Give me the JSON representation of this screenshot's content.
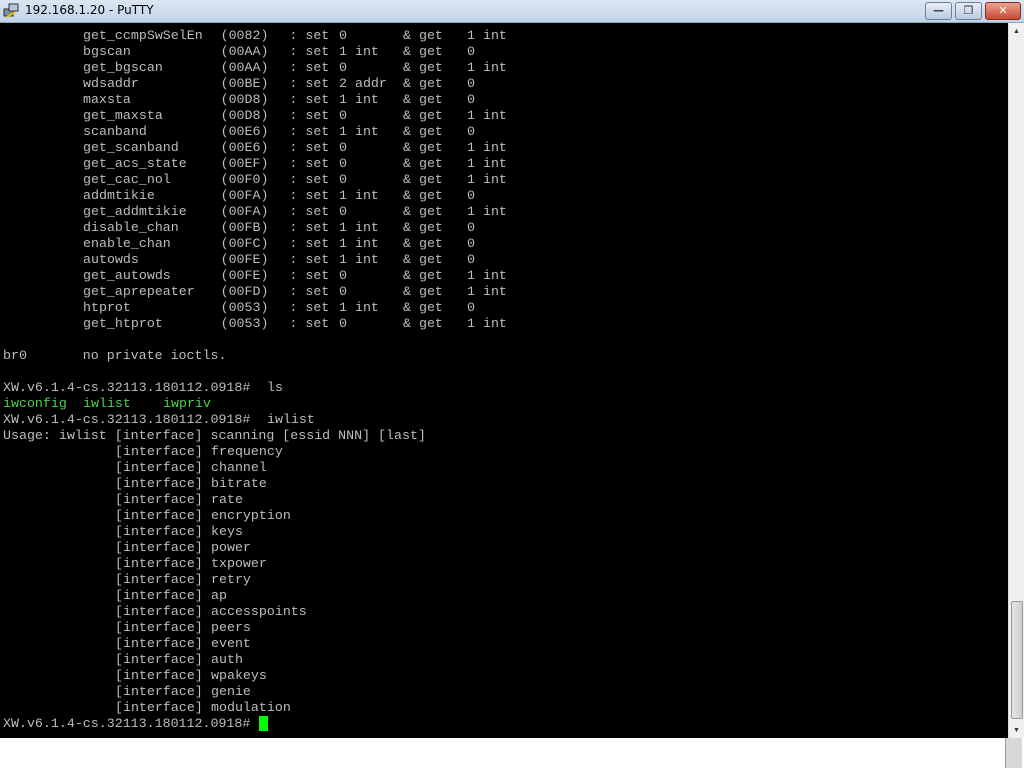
{
  "window": {
    "title": "192.168.1.20 - PuTTY",
    "minimize_label": "—",
    "restore_label": "❐",
    "close_label": "✕"
  },
  "colors": {
    "terminal_bg": "#000000",
    "text": "#bdbdbd",
    "exec_green": "#4fd04f",
    "cursor": "#00ff00"
  },
  "ioctl_table": [
    {
      "name": "get_ccmpSwSelEn",
      "code": "(0082)",
      "set": "0",
      "get": "1 int"
    },
    {
      "name": "bgscan",
      "code": "(00AA)",
      "set": "1 int",
      "get": "0"
    },
    {
      "name": "get_bgscan",
      "code": "(00AA)",
      "set": "0",
      "get": "1 int"
    },
    {
      "name": "wdsaddr",
      "code": "(00BE)",
      "set": "2 addr",
      "get": "0"
    },
    {
      "name": "maxsta",
      "code": "(00D8)",
      "set": "1 int",
      "get": "0"
    },
    {
      "name": "get_maxsta",
      "code": "(00D8)",
      "set": "0",
      "get": "1 int"
    },
    {
      "name": "scanband",
      "code": "(00E6)",
      "set": "1 int",
      "get": "0"
    },
    {
      "name": "get_scanband",
      "code": "(00E6)",
      "set": "0",
      "get": "1 int"
    },
    {
      "name": "get_acs_state",
      "code": "(00EF)",
      "set": "0",
      "get": "1 int"
    },
    {
      "name": "get_cac_nol",
      "code": "(00F0)",
      "set": "0",
      "get": "1 int"
    },
    {
      "name": "addmtikie",
      "code": "(00FA)",
      "set": "1 int",
      "get": "0"
    },
    {
      "name": "get_addmtikie",
      "code": "(00FA)",
      "set": "0",
      "get": "1 int"
    },
    {
      "name": "disable_chan",
      "code": "(00FB)",
      "set": "1 int",
      "get": "0"
    },
    {
      "name": "enable_chan",
      "code": "(00FC)",
      "set": "1 int",
      "get": "0"
    },
    {
      "name": "autowds",
      "code": "(00FE)",
      "set": "1 int",
      "get": "0"
    },
    {
      "name": "get_autowds",
      "code": "(00FE)",
      "set": "0",
      "get": "1 int"
    },
    {
      "name": "get_aprepeater",
      "code": "(00FD)",
      "set": "0",
      "get": "1 int"
    },
    {
      "name": "htprot",
      "code": "(0053)",
      "set": "1 int",
      "get": "0"
    },
    {
      "name": "get_htprot",
      "code": "(0053)",
      "set": "0",
      "get": "1 int"
    }
  ],
  "table_labels": {
    "sep": ": set",
    "amp": "& get"
  },
  "br0_line": "br0       no private ioctls.",
  "prompt": "XW.v6.1.4-cs.32113.180112.0918#",
  "cmd_ls": "ls",
  "ls_output": [
    "iwconfig",
    "iwlist",
    "iwpriv"
  ],
  "cmd_iwlist": "iwlist",
  "usage_line": "Usage: iwlist [interface] scanning [essid NNN] [last]",
  "usage_options": [
    "frequency",
    "channel",
    "bitrate",
    "rate",
    "encryption",
    "keys",
    "power",
    "txpower",
    "retry",
    "ap",
    "accesspoints",
    "peers",
    "event",
    "auth",
    "wpakeys",
    "genie",
    "modulation"
  ],
  "usage_prefix": "[interface]"
}
